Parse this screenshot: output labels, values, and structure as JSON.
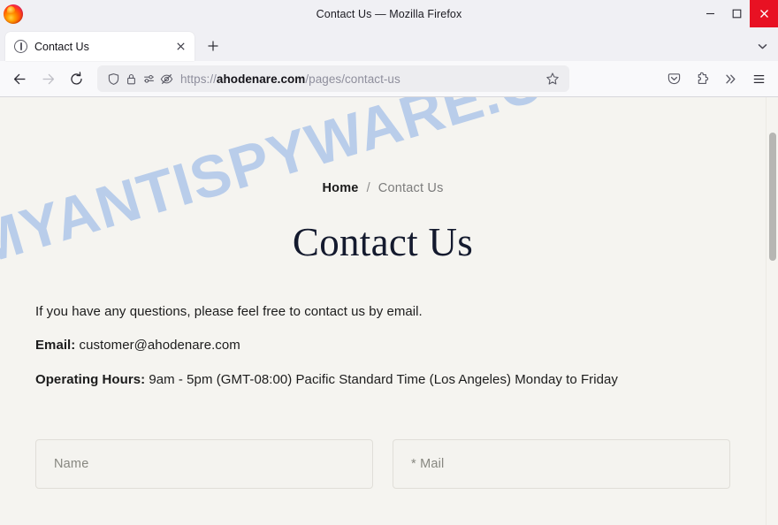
{
  "window": {
    "title": "Contact Us — Mozilla Firefox",
    "minimize_label": "Minimize",
    "maximize_label": "Maximize",
    "close_label": "Close"
  },
  "tabstrip": {
    "tab_title": "Contact Us",
    "tab_close_label": "Close tab",
    "new_tab_label": "New tab",
    "list_tabs_label": "List all tabs"
  },
  "toolbar": {
    "back_label": "Back",
    "forward_label": "Forward",
    "reload_label": "Reload",
    "shield_label": "Tracking protection",
    "lock_label": "Connection secure",
    "permissions_label": "Site permissions",
    "no_autoplay_label": "Autoplay blocked",
    "bookmark_label": "Bookmark this page",
    "pocket_label": "Save to Pocket",
    "extensions_label": "Extensions",
    "overflow_label": "More tools",
    "menu_label": "Open application menu"
  },
  "url": {
    "scheme": "https://",
    "domain": "ahodenare.com",
    "path": "/pages/contact-us",
    "full": "https://ahodenare.com/pages/contact-us"
  },
  "page": {
    "watermark": "MYANTISPYWARE.COM",
    "breadcrumb": {
      "home": "Home",
      "separator": "/",
      "current": "Contact Us"
    },
    "title": "Contact Us",
    "intro": "If you have any questions, please feel free to contact us by email.",
    "email_label": "Email:",
    "email_value": " customer@ahodenare.com",
    "hours_label": "Operating Hours:",
    "hours_value": " 9am - 5pm (GMT-08:00) Pacific Standard Time (Los Angeles) Monday to Friday",
    "form": {
      "name_placeholder": "Name",
      "mail_placeholder": "* Mail"
    }
  },
  "colors": {
    "page_background": "#f5f4f0",
    "watermark": "#a9c3e9",
    "heading": "#141a2e",
    "close_button": "#e81123",
    "field_background": "#f4f3ef"
  }
}
